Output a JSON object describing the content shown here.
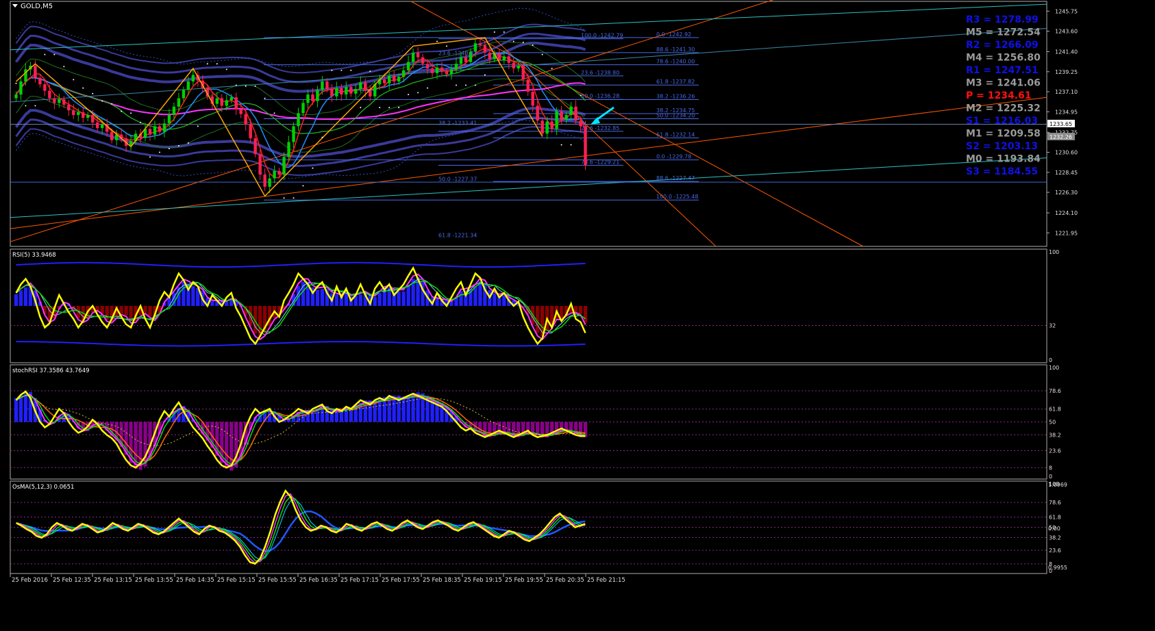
{
  "window": {
    "symbol_label": "GOLD,M5"
  },
  "colors": {
    "background": "#000000",
    "grid": "#202020",
    "bull_candle": "#00d000",
    "bear_candle": "#ff2050",
    "ma_blue": "#1e90ff",
    "ma_red": "#ff2020",
    "ma_green": "#20b020",
    "ma_magenta": "#ff33ff",
    "envelope": "#3a3a9a",
    "zigzag": "#ffa500",
    "fib": "#4a6ae8",
    "trend_orange": "#ff5a00",
    "trend_teal": "#2ec4c4",
    "pivot_blue": "#1010e8",
    "pivot_gray": "#9a9a9a",
    "pivot_red": "#ff1010",
    "rsi_yellow": "#ffff00",
    "hist_blue": "#2020ff",
    "hist_darkred": "#8b0000",
    "hist_purple": "#8a008a",
    "arrow_cyan": "#00e5ff"
  },
  "chart_data": [
    {
      "type": "candlestick",
      "title": "GOLD,M5",
      "ylim": [
        1220.5,
        1246.8
      ],
      "yticks": [
        "1245.75",
        "1243.60",
        "1241.40",
        "1239.25",
        "1237.10",
        "1234.95",
        "1232.75",
        "1230.60",
        "1228.45",
        "1226.30",
        "1224.10",
        "1221.95"
      ],
      "current_price_labels": [
        "1233.65",
        "1232.26"
      ],
      "xticks": [
        "25 Feb 2016",
        "25 Feb 12:35",
        "25 Feb 13:15",
        "25 Feb 13:55",
        "25 Feb 14:35",
        "25 Feb 15:15",
        "25 Feb 15:55",
        "25 Feb 16:35",
        "25 Feb 17:15",
        "25 Feb 17:55",
        "25 Feb 18:35",
        "25 Feb 19:15",
        "25 Feb 19:55",
        "25 Feb 20:35",
        "25 Feb 21:15"
      ],
      "close": [
        1236.8,
        1238.2,
        1239.5,
        1239.9,
        1238.6,
        1237.9,
        1237.2,
        1236.4,
        1235.9,
        1236.3,
        1235.7,
        1235.1,
        1234.6,
        1234.9,
        1234.3,
        1234.6,
        1233.8,
        1233.2,
        1233.6,
        1232.8,
        1231.9,
        1232.5,
        1232.1,
        1231.3,
        1231.8,
        1232.6,
        1232.2,
        1233.1,
        1232.5,
        1233.4,
        1232.8,
        1233.7,
        1234.6,
        1235.5,
        1236.4,
        1237.3,
        1238.2,
        1238.9,
        1238.3,
        1237.5,
        1236.6,
        1235.8,
        1236.4,
        1235.6,
        1236.2,
        1236.5,
        1235.2,
        1234.7,
        1233.6,
        1232.1,
        1230.4,
        1228.2,
        1226.9,
        1227.8,
        1228.6,
        1228.2,
        1230.1,
        1231.7,
        1233.4,
        1234.8,
        1235.9,
        1236.8,
        1236.1,
        1237.3,
        1238.2,
        1237.4,
        1236.6,
        1237.5,
        1236.8,
        1237.6,
        1236.9,
        1237.4,
        1238.1,
        1237.2,
        1236.6,
        1237.9,
        1238.4,
        1238.0,
        1238.8,
        1238.2,
        1238.7,
        1239.4,
        1240.3,
        1241.3,
        1240.8,
        1240.1,
        1239.6,
        1239.1,
        1239.7,
        1239.3,
        1239.0,
        1239.5,
        1240.1,
        1240.8,
        1240.3,
        1241.4,
        1242.3,
        1242.1,
        1241.3,
        1240.6,
        1241.2,
        1240.5,
        1240.9,
        1240.2,
        1239.6,
        1239.9,
        1238.4,
        1237.1,
        1235.6,
        1234.0,
        1232.6,
        1233.9,
        1233.1,
        1235.0,
        1234.1,
        1234.6,
        1235.5,
        1234.0,
        1233.4,
        1229.2
      ],
      "annotations": [
        "23.6 -1240.87",
        "38.2 -1233.41",
        "50.0 -1227.37",
        "61.8 -1221.34"
      ]
    },
    {
      "type": "fibonacci_levels",
      "levels": [
        {
          "label": "0.0 -1242.92",
          "price": 1242.92
        },
        {
          "label": "100.0 -1242.79",
          "price": 1242.79
        },
        {
          "label": "88.6 -1241.30",
          "price": 1241.3
        },
        {
          "label": "78.6 -1240.00",
          "price": 1240.0
        },
        {
          "label": "23.6 -1238.80",
          "price": 1238.8
        },
        {
          "label": "61.8 -1237.82",
          "price": 1237.82
        },
        {
          "label": "38.2 -1236.26",
          "price": 1236.26
        },
        {
          "label": "50.0 -1236.28",
          "price": 1236.28
        },
        {
          "label": "38.2 -1234.75",
          "price": 1234.75
        },
        {
          "label": "50.0 -1234.20",
          "price": 1234.2
        },
        {
          "label": "23.6 -1232.85",
          "price": 1232.85
        },
        {
          "label": "61.8 -1232.14",
          "price": 1232.14
        },
        {
          "label": "0.0 -1229.78",
          "price": 1229.78
        },
        {
          "label": "78.6 -1229.21",
          "price": 1229.21
        },
        {
          "label": "88.6 -1227.47",
          "price": 1227.47
        },
        {
          "label": "100.0 -1225.48",
          "price": 1225.48
        }
      ]
    },
    {
      "type": "pivot_levels",
      "levels": [
        {
          "label": "R3 = 1278.99",
          "kind": "resistance"
        },
        {
          "label": "M5 = 1272.54",
          "kind": "mid"
        },
        {
          "label": "R2 = 1266.09",
          "kind": "resistance"
        },
        {
          "label": "M4 = 1256.80",
          "kind": "mid"
        },
        {
          "label": "R1 = 1247.51",
          "kind": "resistance"
        },
        {
          "label": "M3 = 1241.06",
          "kind": "mid"
        },
        {
          "label": "P  = 1234.61",
          "kind": "pivot"
        },
        {
          "label": "M2 = 1225.32",
          "kind": "mid"
        },
        {
          "label": "S1 = 1216.03",
          "kind": "support"
        },
        {
          "label": "M1 = 1209.58",
          "kind": "mid"
        },
        {
          "label": "S2 = 1203.13",
          "kind": "support"
        },
        {
          "label": "M0 = 1193.84",
          "kind": "mid"
        },
        {
          "label": "S3 = 1184.55",
          "kind": "support"
        }
      ]
    },
    {
      "type": "line",
      "title": "RSI(5) 33.9468",
      "ylim": [
        0,
        100
      ],
      "yticks": [
        "100",
        "32",
        "0"
      ],
      "values": [
        62,
        70,
        75,
        68,
        55,
        40,
        30,
        34,
        48,
        60,
        52,
        44,
        38,
        30,
        36,
        45,
        50,
        42,
        35,
        30,
        38,
        48,
        40,
        33,
        30,
        41,
        50,
        38,
        30,
        42,
        55,
        63,
        58,
        70,
        80,
        74,
        65,
        72,
        68,
        56,
        50,
        60,
        55,
        50,
        58,
        62,
        48,
        40,
        30,
        20,
        15,
        22,
        30,
        38,
        45,
        40,
        55,
        62,
        70,
        80,
        75,
        70,
        62,
        68,
        72,
        62,
        55,
        68,
        58,
        66,
        55,
        60,
        70,
        60,
        52,
        66,
        72,
        65,
        70,
        60,
        65,
        70,
        78,
        85,
        75,
        65,
        58,
        52,
        62,
        55,
        50,
        58,
        66,
        72,
        60,
        70,
        80,
        76,
        65,
        58,
        66,
        58,
        62,
        55,
        50,
        54,
        40,
        30,
        22,
        15,
        20,
        38,
        30,
        45,
        36,
        42,
        52,
        38,
        35,
        25
      ],
      "annotations": [
        "32"
      ]
    },
    {
      "type": "line",
      "title": "stochRSI 37.3586 43.7649",
      "ylim": [
        0,
        100
      ],
      "yticks": [
        "100",
        "78.6",
        "61.8",
        "50",
        "38.2",
        "23.6",
        "8",
        "0"
      ],
      "values": [
        70,
        75,
        78,
        72,
        60,
        50,
        45,
        48,
        55,
        62,
        58,
        50,
        44,
        40,
        42,
        46,
        52,
        48,
        42,
        38,
        35,
        30,
        22,
        15,
        10,
        8,
        12,
        18,
        28,
        40,
        52,
        60,
        55,
        62,
        68,
        60,
        52,
        45,
        40,
        35,
        28,
        22,
        15,
        10,
        8,
        10,
        18,
        30,
        45,
        55,
        62,
        58,
        60,
        62,
        55,
        50,
        52,
        55,
        58,
        62,
        60,
        58,
        62,
        64,
        66,
        60,
        58,
        62,
        60,
        64,
        62,
        66,
        70,
        68,
        66,
        70,
        72,
        70,
        74,
        72,
        70,
        72,
        74,
        76,
        74,
        72,
        70,
        68,
        66,
        64,
        60,
        55,
        50,
        45,
        42,
        44,
        40,
        38,
        36,
        38,
        40,
        42,
        40,
        38,
        36,
        38,
        40,
        42,
        38,
        36,
        37,
        38,
        40,
        42,
        44,
        42,
        40,
        38,
        37,
        37
      ],
      "annotations": [
        "100",
        "78.6",
        "61.8",
        "50",
        "38.2",
        "23.6",
        "8",
        "0"
      ]
    },
    {
      "type": "line",
      "title": "OsMA(5,12,3) 0.0651",
      "ylim": [
        0,
        100
      ],
      "yticks": [
        "100",
        "78.6",
        "61.8",
        "50",
        "38.2",
        "23.6",
        "8",
        "0"
      ],
      "right_labels": [
        "1.0969",
        "0.00",
        "0.9955"
      ],
      "values": [
        55,
        52,
        48,
        45,
        40,
        38,
        42,
        50,
        55,
        52,
        48,
        46,
        50,
        54,
        52,
        48,
        44,
        46,
        50,
        55,
        52,
        48,
        46,
        50,
        54,
        52,
        48,
        44,
        42,
        45,
        50,
        55,
        60,
        55,
        50,
        45,
        42,
        48,
        52,
        50,
        46,
        44,
        40,
        35,
        28,
        18,
        10,
        8,
        14,
        28,
        45,
        65,
        80,
        92,
        85,
        70,
        58,
        50,
        46,
        48,
        52,
        50,
        46,
        44,
        48,
        54,
        52,
        48,
        46,
        50,
        54,
        56,
        52,
        48,
        46,
        50,
        55,
        58,
        54,
        50,
        48,
        52,
        56,
        58,
        55,
        52,
        48,
        46,
        50,
        54,
        56,
        52,
        48,
        44,
        40,
        38,
        42,
        46,
        44,
        40,
        36,
        34,
        38,
        42,
        48,
        55,
        62,
        66,
        60,
        55,
        50,
        52,
        54
      ],
      "annotations": [
        "1.0969",
        "0.00",
        "0.9955"
      ]
    }
  ]
}
